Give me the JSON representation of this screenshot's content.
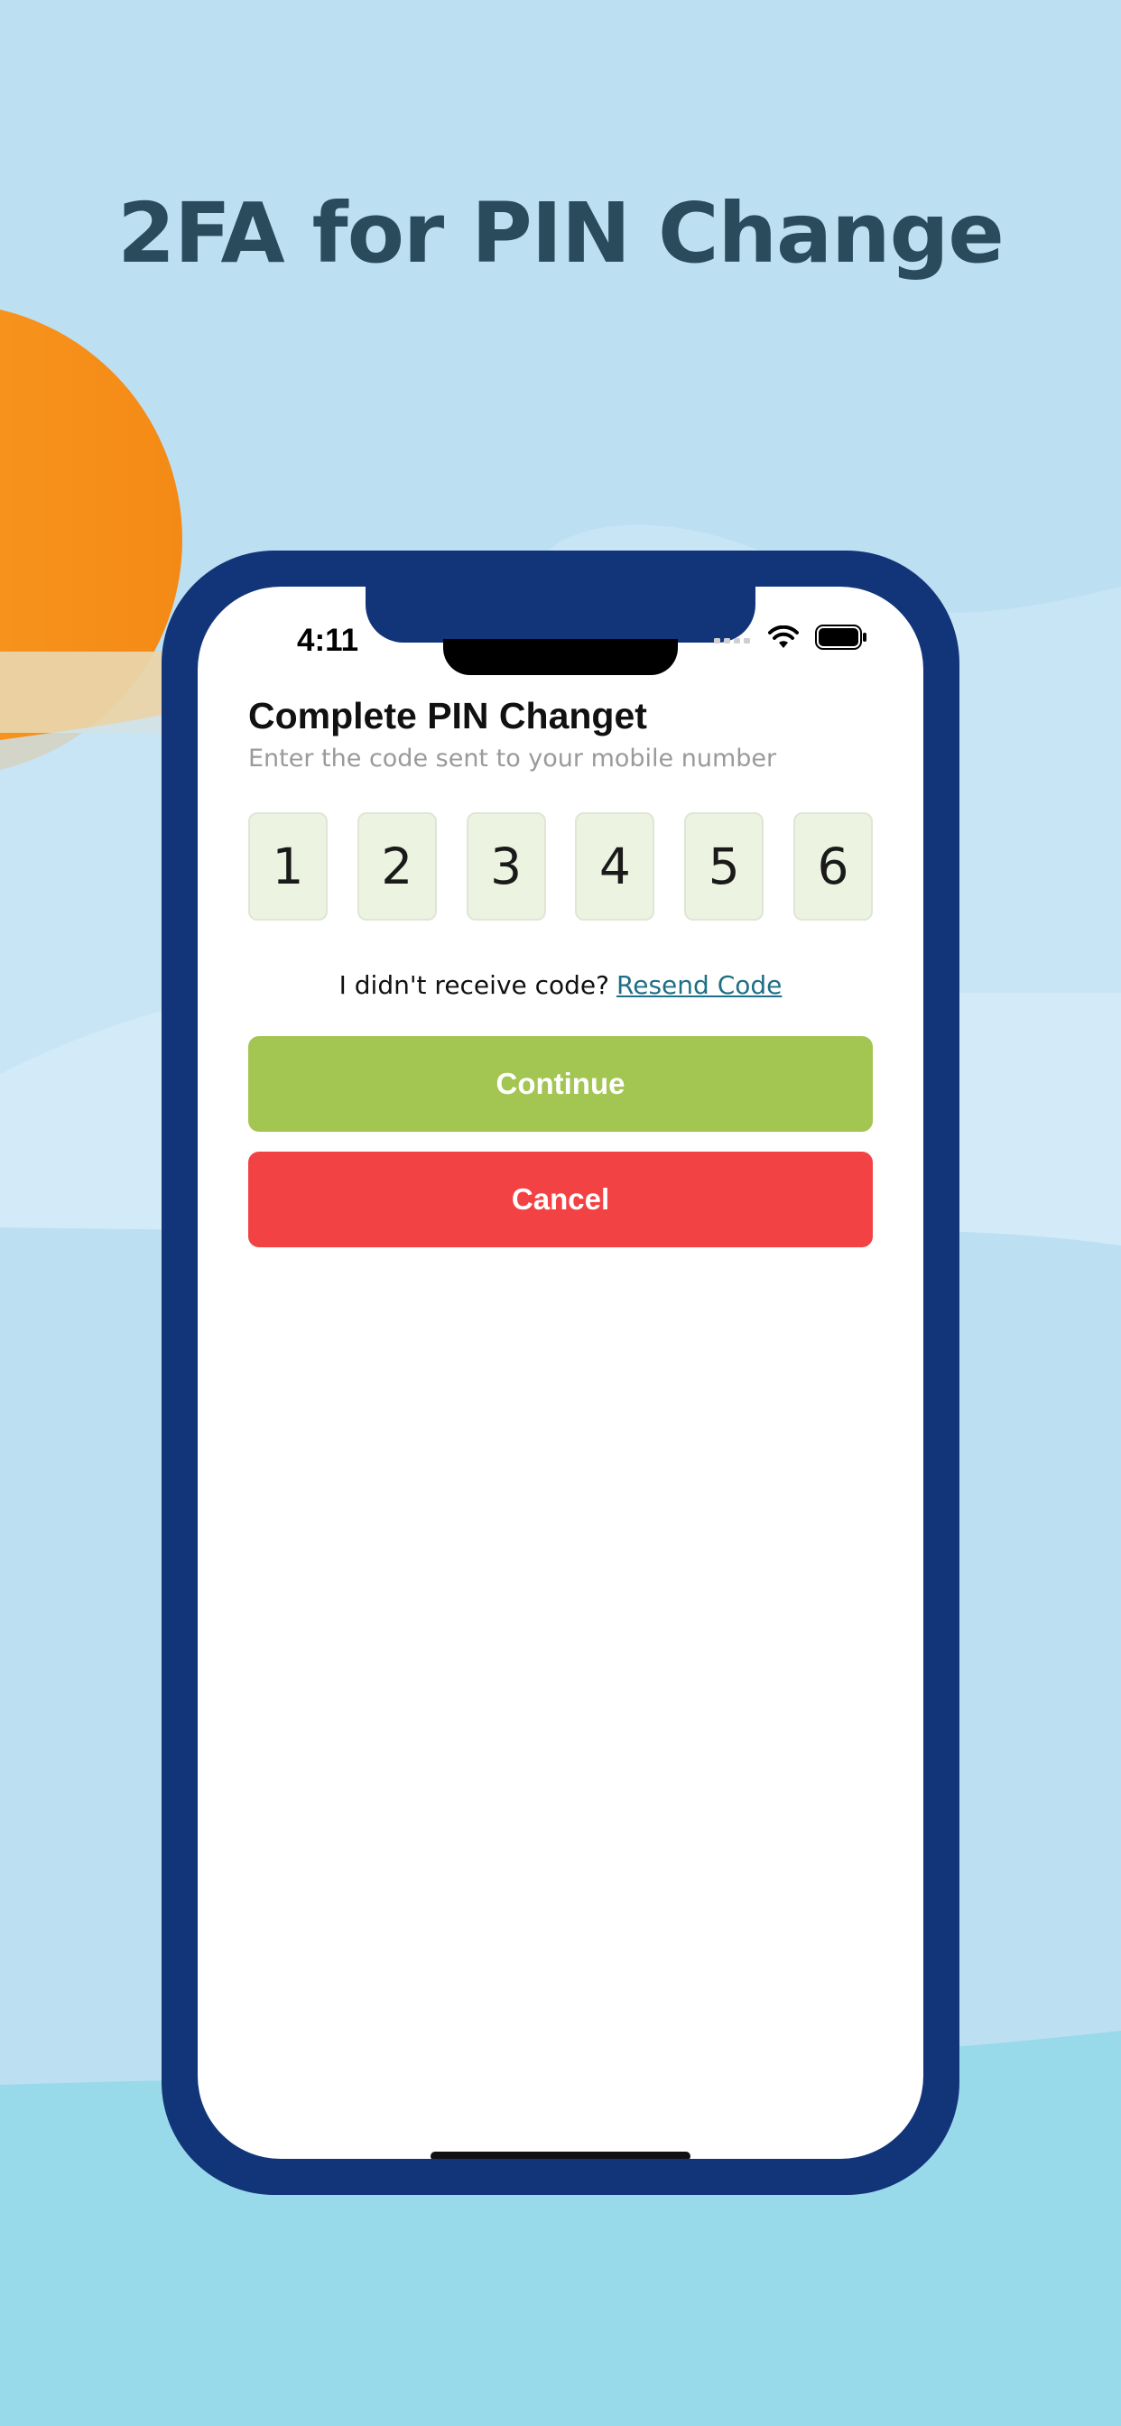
{
  "headline": "2FA for PIN Change",
  "status_bar": {
    "time": "4:11",
    "icons": [
      "signal-icon",
      "wifi-icon",
      "battery-icon"
    ]
  },
  "screen": {
    "title": "Complete PIN Changet",
    "subtitle": "Enter the code sent to your mobile number",
    "otp_digits": [
      "1",
      "2",
      "3",
      "4",
      "5",
      "6"
    ],
    "resend_prompt": "I didn't receive code?",
    "resend_link": "Resend Code",
    "continue_label": "Continue",
    "cancel_label": "Cancel"
  },
  "colors": {
    "sky": "#bddff2",
    "ground": "#98d9ea",
    "sun": "#f7951d",
    "phone_frame": "#12357a",
    "headline": "#2a4b5c",
    "continue": "#a3c552",
    "cancel": "#f24244",
    "otp_box": "#ecf3e0",
    "link": "#1f6f86"
  }
}
